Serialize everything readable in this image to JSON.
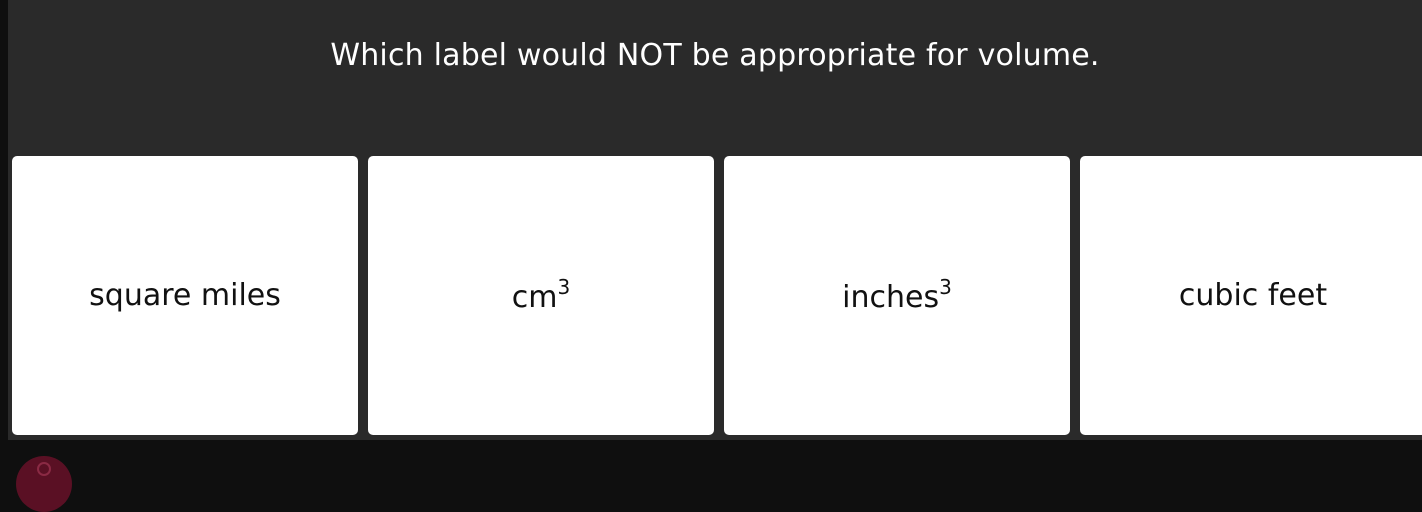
{
  "question": {
    "text": "Which label would NOT be appropriate for volume."
  },
  "options": [
    {
      "text": "square miles",
      "sup": ""
    },
    {
      "text": "cm",
      "sup": "3"
    },
    {
      "text": "inches",
      "sup": "3"
    },
    {
      "text": "cubic feet",
      "sup": ""
    }
  ],
  "fab": {
    "icon": "partial-circle-icon",
    "color": "#5a1024"
  }
}
